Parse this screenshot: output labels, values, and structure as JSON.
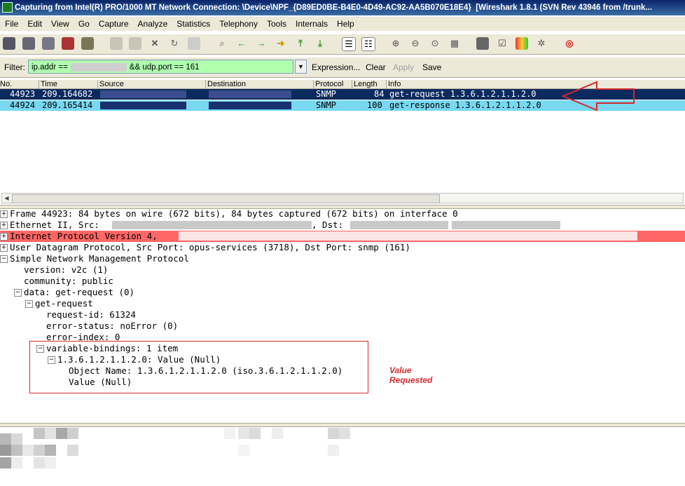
{
  "window": {
    "title": "Capturing from Intel(R) PRO/1000 MT Network Connection: \\Device\\NPF_{D89ED0BE-B4E0-4D49-AC92-AA5B070E18E4}",
    "app_title": "[Wireshark 1.8.1  (SVN Rev 43946 from /trunk..."
  },
  "menu": [
    "File",
    "Edit",
    "View",
    "Go",
    "Capture",
    "Analyze",
    "Statistics",
    "Telephony",
    "Tools",
    "Internals",
    "Help"
  ],
  "toolbar_icons": [
    "interface-list-icon",
    "capture-options-icon",
    "start-capture-icon",
    "stop-capture-icon",
    "restart-capture-icon",
    "open-file-icon",
    "save-file-icon",
    "close-file-icon",
    "reload-icon",
    "print-icon",
    "find-packet-icon",
    "go-back-icon",
    "go-forward-icon",
    "go-to-packet-icon",
    "go-first-icon",
    "go-last-icon",
    "colorize-icon",
    "auto-scroll-icon",
    "zoom-in-icon",
    "zoom-out-icon",
    "normal-size-icon",
    "resize-columns-icon",
    "capture-filters-icon",
    "display-filters-icon",
    "coloring-rules-icon",
    "preferences-icon",
    "help-icon"
  ],
  "filter": {
    "label": "Filter:",
    "value_prefix": "ip.addr ==",
    "value_suffix": "&& udp.port == 161",
    "expression": "Expression...",
    "clear": "Clear",
    "apply": "Apply",
    "save": "Save"
  },
  "columns": [
    "No.",
    "Time",
    "Source",
    "Destination",
    "Protocol",
    "Length",
    "Info"
  ],
  "packets": [
    {
      "no": "44923",
      "time": "209.164682",
      "protocol": "SNMP",
      "length": "84",
      "info": "get-request 1.3.6.1.2.1.1.2.0"
    },
    {
      "no": "44924",
      "time": "209.165414",
      "protocol": "SNMP",
      "length": "100",
      "info": "get-response 1.3.6.1.2.1.1.2.0"
    }
  ],
  "details": {
    "frame": "Frame 44923: 84 bytes on wire (672 bits), 84 bytes captured (672 bits) on interface 0",
    "ethernet_src": "Ethernet II, Src:",
    "ethernet_dst": ", Dst:",
    "ip": "Internet Protocol Version 4,",
    "udp": "User Datagram Protocol, Src Port: opus-services (3718), Dst Port: snmp (161)",
    "snmp": "Simple Network Management Protocol",
    "version": "version: v2c (1)",
    "community": "community: public",
    "data": "data: get-request (0)",
    "get_request": "get-request",
    "request_id": "request-id: 61324",
    "error_status": "error-status: noError (0)",
    "error_index": "error-index: 0",
    "variable_bindings": "variable-bindings: 1 item",
    "binding": "1.3.6.1.2.1.1.2.0: Value (Null)",
    "object_name": "Object Name: 1.3.6.1.2.1.1.2.0 (iso.3.6.1.2.1.1.2.0)",
    "value": "Value (Null)"
  },
  "annotation": {
    "line1": "Value",
    "line2": "Requested",
    "color": "#d42a2a"
  },
  "colors": {
    "selected_row": "#0b2a5e",
    "snmp_row": "#78d8f0",
    "ip_highlight": "#ff6666",
    "filter_ok": "#afffaf"
  }
}
